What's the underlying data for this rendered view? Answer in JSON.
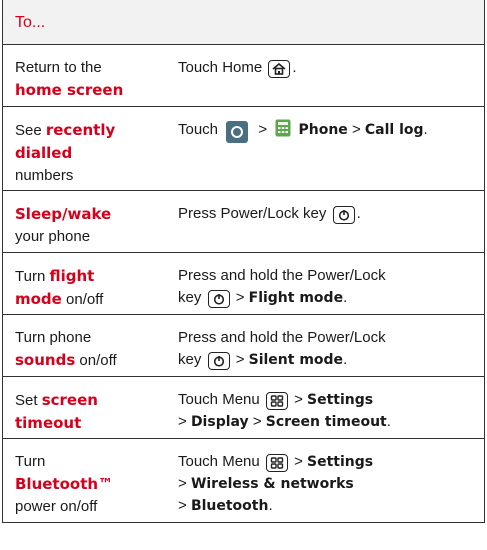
{
  "header": "To...",
  "rows": [
    {
      "a1": "Return to the",
      "a2": "home screen",
      "b1": "Touch Home",
      "b2": "."
    },
    {
      "a1": "See ",
      "a2": "recently",
      "a3": "dialled",
      "a4": "numbers",
      "b1": "Touch",
      "b2": ">",
      "b3": "Phone",
      "b4": ">",
      "b5": "Call log",
      "b6": "."
    },
    {
      "a1": "Sleep/wake",
      "a2": "your phone",
      "b1": "Press Power/Lock key",
      "b2": "."
    },
    {
      "a1": "Turn ",
      "a2": "flight",
      "a3": "mode",
      "a4": " on/off",
      "b1": "Press and hold the Power/Lock",
      "b2": "key",
      "b3": ">",
      "b4": "Flight mode",
      "b5": "."
    },
    {
      "a1": "Turn phone",
      "a2": "sounds",
      "a3": " on/off",
      "b1": "Press and hold the Power/Lock",
      "b2": "key",
      "b3": ">",
      "b4": "Silent mode",
      "b5": "."
    },
    {
      "a1": "Set ",
      "a2": "screen",
      "a3": "timeout",
      "b1": "Touch Menu",
      "b2": ">",
      "b3": "Settings",
      "b4": ">",
      "b5": "Display",
      "b6": ">",
      "b7": "Screen timeout",
      "b8": "."
    },
    {
      "a1": "Turn",
      "a2": "Bluetooth™",
      "a3": "power on/off",
      "b1": "Touch Menu",
      "b2": ">",
      "b3": "Settings",
      "b4": ">",
      "b5": "Wireless & networks",
      "b6": ">",
      "b7": "Bluetooth",
      "b8": "."
    }
  ],
  "colors": {
    "accent": "#d6001c",
    "header_bg": "#f2f2f2"
  },
  "icons": [
    "home-key-icon",
    "app-launcher-icon",
    "phone-app-icon",
    "power-key-icon",
    "menu-key-icon"
  ]
}
